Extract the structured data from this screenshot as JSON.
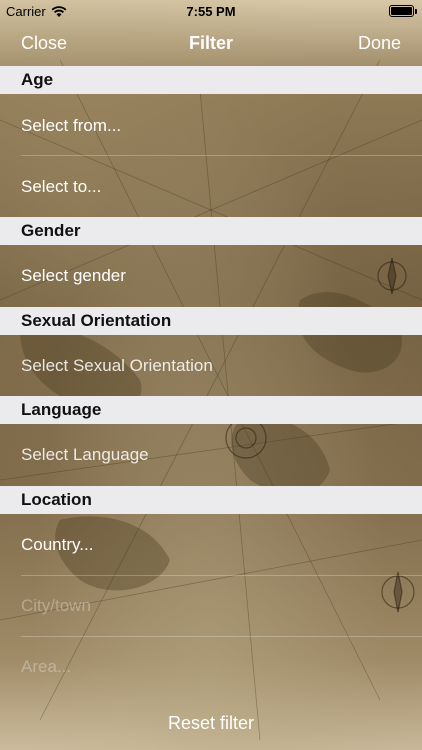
{
  "status": {
    "carrier": "Carrier",
    "time": "7:55 PM"
  },
  "nav": {
    "close_label": "Close",
    "title": "Filter",
    "done_label": "Done"
  },
  "sections": {
    "age": {
      "header": "Age",
      "from_placeholder": "Select from...",
      "to_placeholder": "Select to..."
    },
    "gender": {
      "header": "Gender",
      "placeholder": "Select gender"
    },
    "orientation": {
      "header": "Sexual Orientation",
      "placeholder": "Select Sexual Orientation"
    },
    "language": {
      "header": "Language",
      "placeholder": "Select Language"
    },
    "location": {
      "header": "Location",
      "country_placeholder": "Country...",
      "city_placeholder": "City/town",
      "area_placeholder": "Area..."
    }
  },
  "footer": {
    "reset_label": "Reset filter"
  },
  "icons": {
    "wifi": "wifi-icon",
    "battery": "battery-icon",
    "background": "world-map-background"
  }
}
